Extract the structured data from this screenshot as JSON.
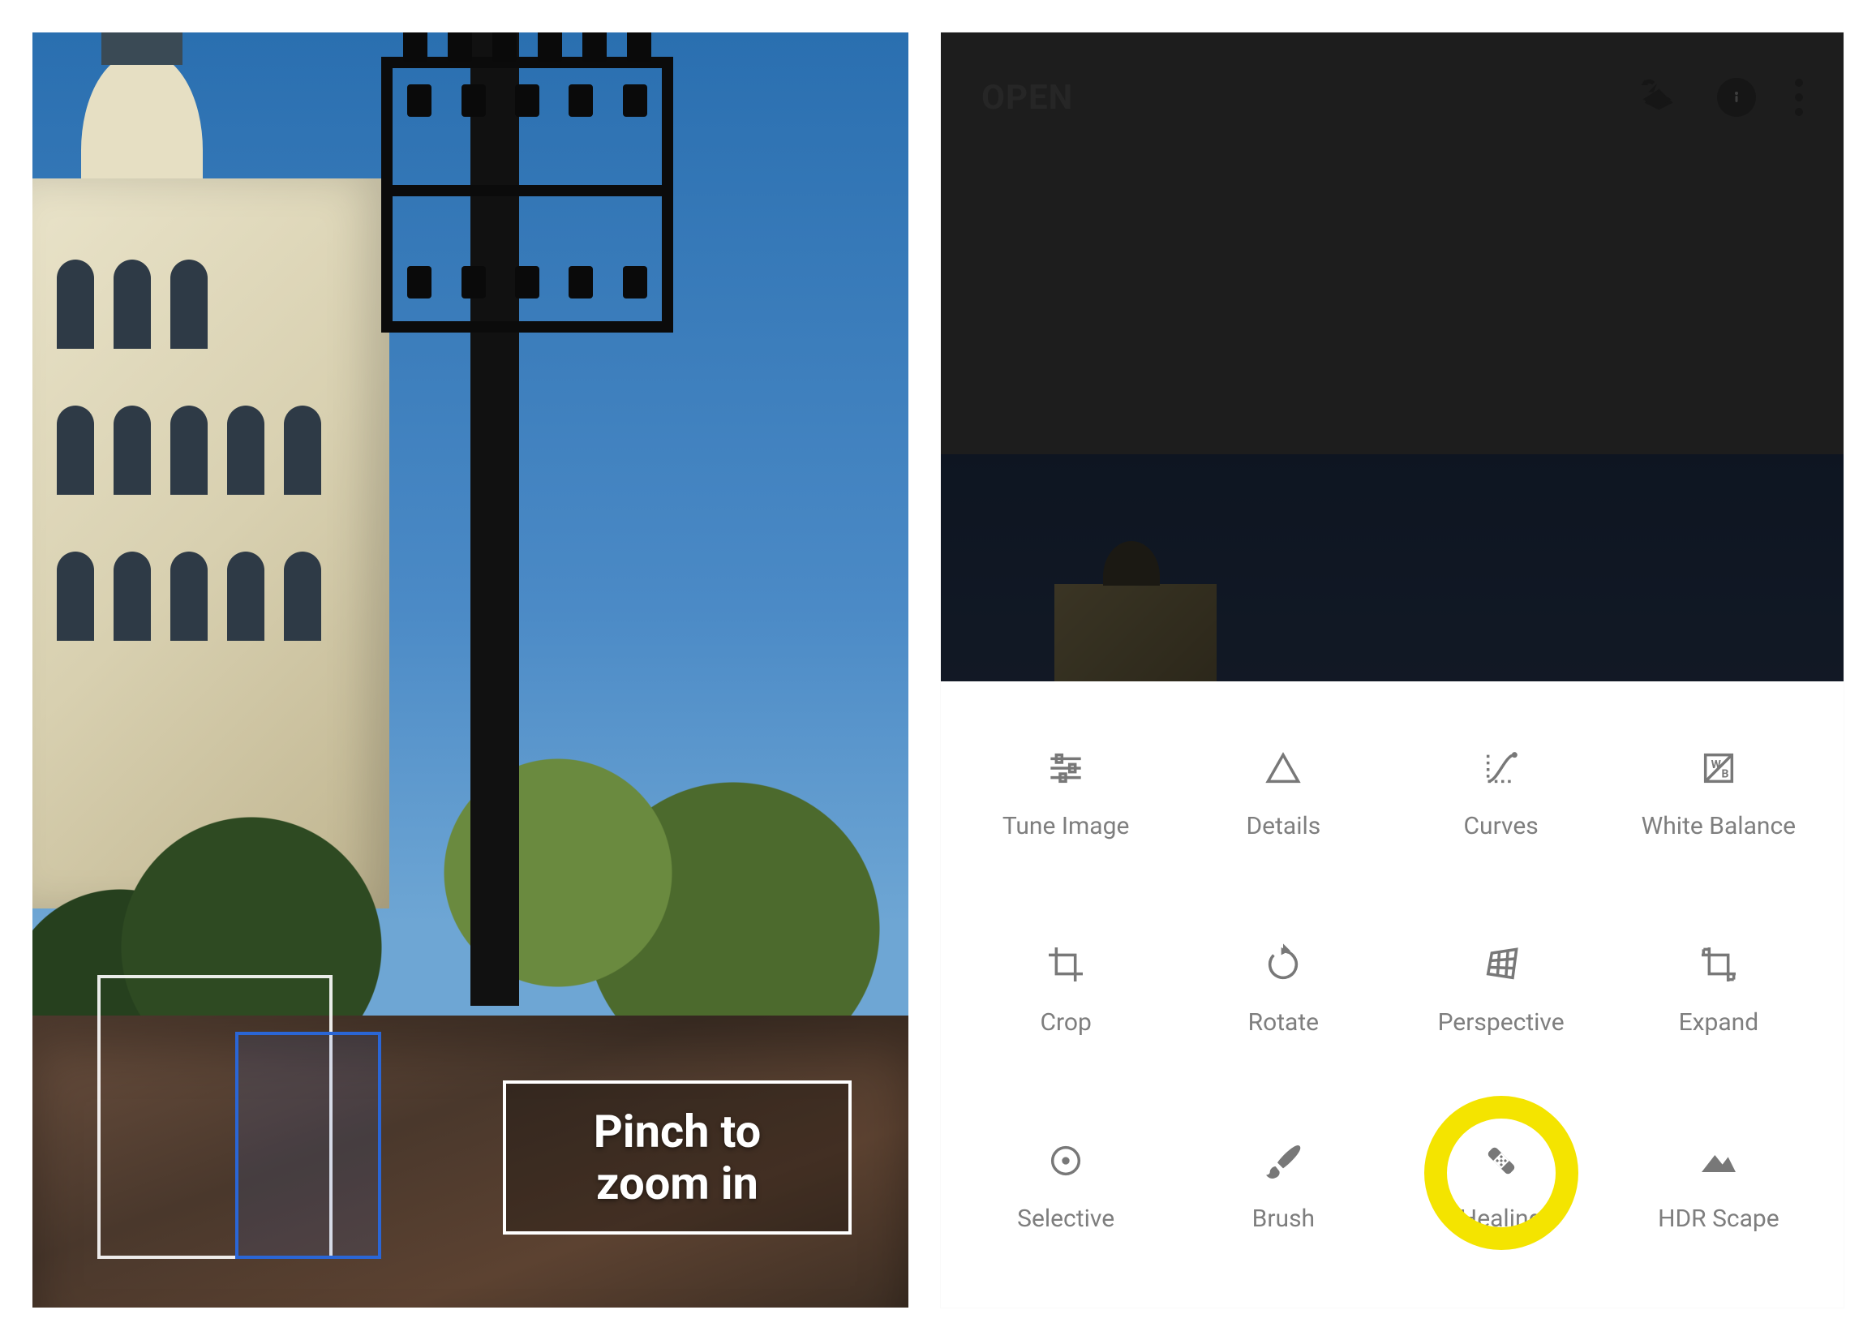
{
  "left": {
    "overlay_line1": "Pinch to",
    "overlay_line2": "zoom in"
  },
  "right": {
    "topbar": {
      "open_label": "OPEN"
    },
    "tools": [
      {
        "key": "tune",
        "label": "Tune Image",
        "icon": "tune-icon"
      },
      {
        "key": "details",
        "label": "Details",
        "icon": "details-icon"
      },
      {
        "key": "curves",
        "label": "Curves",
        "icon": "curves-icon"
      },
      {
        "key": "wb",
        "label": "White Balance",
        "icon": "white-balance-icon"
      },
      {
        "key": "crop",
        "label": "Crop",
        "icon": "crop-icon"
      },
      {
        "key": "rotate",
        "label": "Rotate",
        "icon": "rotate-icon"
      },
      {
        "key": "perspective",
        "label": "Perspective",
        "icon": "perspective-icon"
      },
      {
        "key": "expand",
        "label": "Expand",
        "icon": "expand-icon"
      },
      {
        "key": "selective",
        "label": "Selective",
        "icon": "selective-icon"
      },
      {
        "key": "brush",
        "label": "Brush",
        "icon": "brush-icon"
      },
      {
        "key": "healing",
        "label": "Healing",
        "icon": "healing-icon"
      },
      {
        "key": "hdr",
        "label": "HDR Scape",
        "icon": "hdr-scape-icon"
      }
    ],
    "highlighted_tool": "healing"
  }
}
